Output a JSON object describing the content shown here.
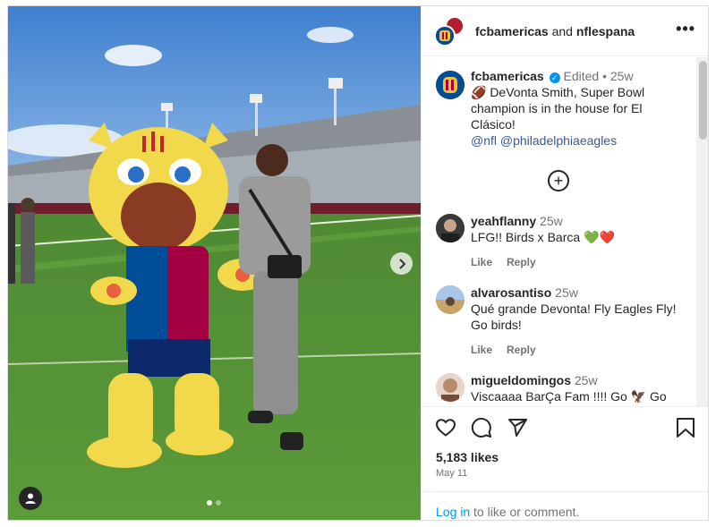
{
  "header": {
    "account_primary": "fcbamericas",
    "and_text": "and",
    "account_secondary": "nflespana",
    "more_label": "•••"
  },
  "caption": {
    "username": "fcbamericas",
    "verified_mark": "✓",
    "edited": "Edited",
    "separator": "•",
    "time": "25w",
    "text": "🏈 DeVonta Smith, Super Bowl champion is in the house for El Clásico!",
    "mention_1": "@nfl",
    "mention_2": "@philadelphiaeagles"
  },
  "load_more_label": "+",
  "comments": [
    {
      "username": "yeahflanny",
      "time": "25w",
      "text": "LFG!! Birds x Barca 💚❤️",
      "like_label": "Like",
      "reply_label": "Reply"
    },
    {
      "username": "alvarosantiso",
      "time": "25w",
      "text": "Qué grande Devonta! Fly Eagles Fly! Go birds!",
      "like_label": "Like",
      "reply_label": "Reply"
    },
    {
      "username": "migueldomingos",
      "time": "25w",
      "text": "Viscaaaa BarÇa Fam !!!! Go 🦅 Go"
    }
  ],
  "stats": {
    "likes": "5,183 likes",
    "date": "May 11"
  },
  "login": {
    "link": "Log in",
    "rest": " to like or comment."
  },
  "icons": {
    "like": "heart-icon",
    "comment": "comment-icon",
    "share": "share-icon",
    "save": "bookmark-icon",
    "next": "chevron-right-icon",
    "tags": "user-tag-icon"
  },
  "carousel": {
    "slide_count": 2,
    "active_slide": 1
  },
  "colors": {
    "link_blue": "#0095f6",
    "mention_blue": "#00376b",
    "muted": "#737373",
    "verified": "#0095f6"
  }
}
